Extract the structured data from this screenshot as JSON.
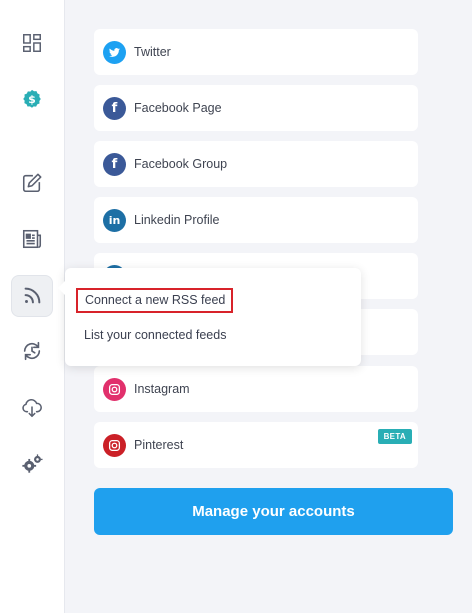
{
  "sidebar": {
    "items": [
      {
        "icon": "dashboard-icon"
      },
      {
        "icon": "dollar-badge-icon",
        "color": "#29aeb5"
      },
      {
        "icon": "compose-icon"
      },
      {
        "icon": "newspaper-icon"
      },
      {
        "icon": "rss-icon",
        "active": true
      },
      {
        "icon": "sync-clock-icon"
      },
      {
        "icon": "cloud-download-icon"
      },
      {
        "icon": "settings-gears-icon"
      }
    ]
  },
  "accounts": [
    {
      "label": "Twitter",
      "icon": "twitter-icon",
      "color": "#1da1f2"
    },
    {
      "label": "Facebook Page",
      "icon": "facebook-icon",
      "color": "#3b5998"
    },
    {
      "label": "Facebook Group",
      "icon": "facebook-icon",
      "color": "#3b5998"
    },
    {
      "label": "Linkedin Profile",
      "icon": "linkedin-icon",
      "color": "#1d6fa5"
    },
    {
      "label": "",
      "icon": "",
      "color": "#1d6fa5"
    },
    {
      "label": "",
      "icon": "",
      "color": ""
    },
    {
      "label": "Instagram",
      "icon": "instagram-icon",
      "color": "#e1306c"
    },
    {
      "label": "Pinterest",
      "icon": "pinterest-icon",
      "color": "#cb2027",
      "badge": "BETA"
    }
  ],
  "manage_button": "Manage your accounts",
  "rss_menu": {
    "connect_label": "Connect a new RSS feed",
    "list_label": "List your connected feeds"
  },
  "colors": {
    "accent": "#1fa0ee",
    "teal": "#29aeb5",
    "highlight_border": "#d8232a"
  }
}
